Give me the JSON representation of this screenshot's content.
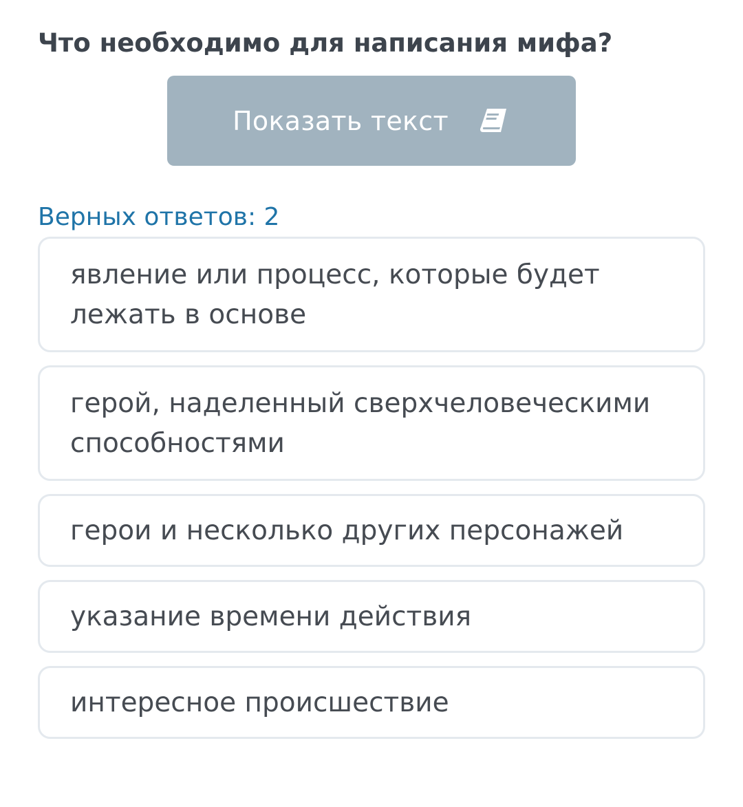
{
  "question": {
    "text": "Что необходимо для написания мифа?"
  },
  "show_text_button": {
    "label": "Показать текст",
    "icon": "book-icon",
    "background": "#a1b3bf"
  },
  "correct_count": {
    "label": "Верных ответов: 2"
  },
  "options": [
    {
      "label": "явление или процесс, которые будет лежать в основе"
    },
    {
      "label": "герой, наделенный сверхчеловеческими способностями"
    },
    {
      "label": "герои и несколько других персонажей"
    },
    {
      "label": "указание времени действия"
    },
    {
      "label": "интересное происшествие"
    }
  ],
  "colors": {
    "question_text": "#3d444d",
    "accent": "#1f74a8",
    "option_border": "#e4e9ee",
    "option_text": "#464b52"
  }
}
